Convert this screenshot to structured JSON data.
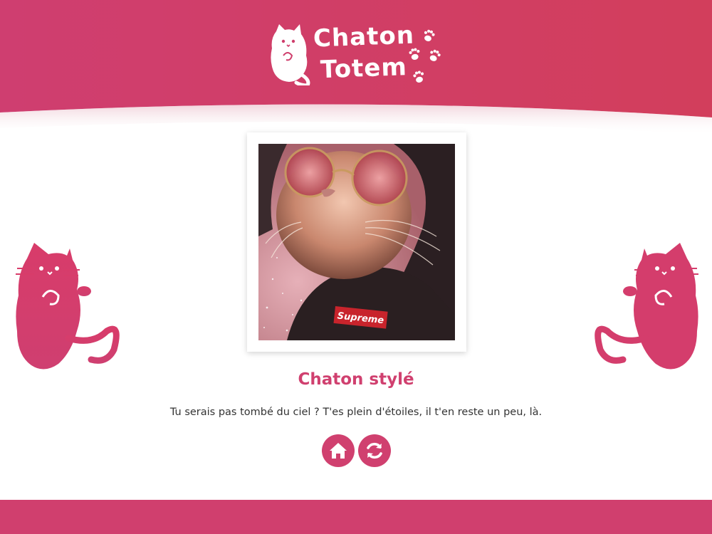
{
  "brand": {
    "line1": "Chaton",
    "line2": "Totem",
    "primary_color": "#d0406f",
    "header_gradient": [
      "#cf3e70",
      "#d23e5c"
    ]
  },
  "card": {
    "image_alt": "Chat avec lunettes de soleil rondes et sweat à capuche noir",
    "image_caption_text": "Supreme",
    "title": "Chaton stylé",
    "description": "Tu serais pas tombé du ciel ? T'es plein d'étoiles, il t'en reste un peu, là."
  },
  "actions": {
    "home_icon": "home-icon",
    "refresh_icon": "refresh-icon"
  },
  "decorations": {
    "left_cat": "cat-silhouette-icon",
    "right_cat": "cat-silhouette-icon",
    "paws": "paw-prints-icon"
  }
}
